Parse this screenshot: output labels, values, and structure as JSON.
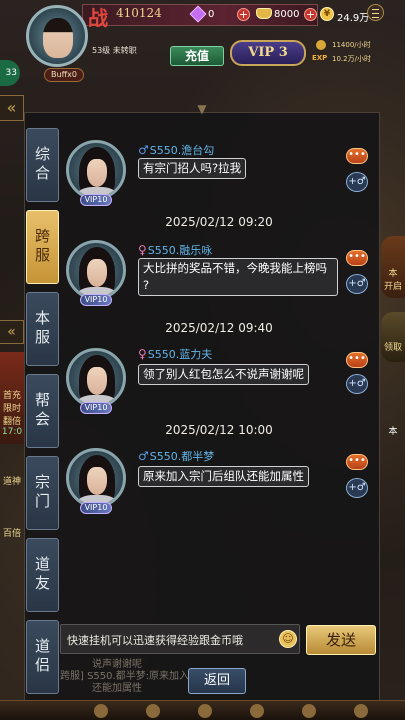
{
  "hud": {
    "power_char": "战",
    "power_value": "410124",
    "gems": "0",
    "gold": "8000",
    "coins": "24.9万",
    "level": "53级 未转职",
    "player_name": "Buffx0",
    "recharge_label": "充值",
    "vip_label": "VIP 3",
    "rate_gold": "11400/小时",
    "exp_label": "EXP",
    "rate_exp": "10.2万/小时",
    "side_badge": "33"
  },
  "tabs": [
    {
      "label": "综合",
      "active": false
    },
    {
      "label": "跨服",
      "active": true
    },
    {
      "label": "本服",
      "active": false
    },
    {
      "label": "帮会",
      "active": false
    },
    {
      "label": "宗门",
      "active": false
    },
    {
      "label": "道友",
      "active": false
    },
    {
      "label": "道侣",
      "active": false
    }
  ],
  "messages": [
    {
      "sender": "S550.澹台勾",
      "sex": "♂",
      "text": "有宗门招人吗?拉我",
      "vip": "VIP10",
      "timestamp": ""
    },
    {
      "sender": "S550.融乐咏",
      "sex": "♀",
      "text": "大比拼的奖品不错，今晚我能上榜吗\n?",
      "vip": "VIP10",
      "timestamp": "2025/02/12  09:20"
    },
    {
      "sender": "S550.蓝力夫",
      "sex": "♀",
      "text": "领了别人红包怎么不说声谢谢呢",
      "vip": "VIP10",
      "timestamp": "2025/02/12  09:40"
    },
    {
      "sender": "S550.都半梦",
      "sex": "♂",
      "text": "原来加入宗门后组队还能加属性",
      "vip": "VIP10",
      "timestamp": "2025/02/12  10:00"
    }
  ],
  "input": {
    "value": "快速挂机可以迅速获得经验跟金币哦"
  },
  "send_label": "发送",
  "back_label": "返回",
  "ghost": {
    "line1": "说声谢谢呢",
    "line2": "跨服] S550.都半梦:原来加入宗门后组队",
    "line3": "还能加属性"
  },
  "edge": {
    "left_labels": [
      "首充",
      "限时",
      "翻倍",
      "17:0",
      "道神",
      "百倍"
    ],
    "right_labels": [
      "本",
      "开启",
      "领取",
      "本"
    ]
  },
  "colors": {
    "tab_active": "#e8c06a",
    "tab_inactive": "#3a4a5c",
    "sender_name": "#62b4e8",
    "send_button": "#e8c878"
  }
}
